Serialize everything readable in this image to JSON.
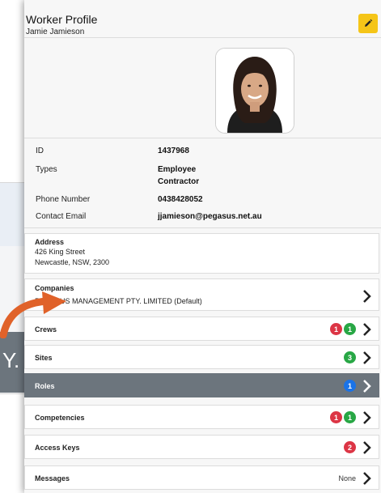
{
  "header": {
    "title": "Worker Profile",
    "subtitle": "Jamie Jamieson"
  },
  "details": [
    {
      "label": "ID",
      "value": "1437968"
    },
    {
      "label": "Types",
      "value": "Employee",
      "value2": "Contractor"
    },
    {
      "label": "Phone Number",
      "value": "0438428052"
    },
    {
      "label": "Contact Email",
      "value": "jjamieson@pegasus.net.au"
    }
  ],
  "address": {
    "label": "Address",
    "line1": "426 King Street",
    "line2": "Newcastle, NSW, 2300"
  },
  "companies": {
    "label": "Companies",
    "value": "PEGASUS MANAGEMENT PTY. LIMITED (Default)"
  },
  "nav": [
    {
      "label": "Crews",
      "badges": [
        {
          "count": "1",
          "color": "#dc3545"
        },
        {
          "count": "1",
          "color": "#28a745"
        }
      ]
    },
    {
      "label": "Sites",
      "badges": [
        {
          "count": "3",
          "color": "#28a745"
        }
      ]
    },
    {
      "label": "Roles",
      "badges": [
        {
          "count": "1",
          "color": "#1a73e8"
        }
      ],
      "active": true
    },
    {
      "label": "Competencies",
      "badges": [
        {
          "count": "1",
          "color": "#dc3545"
        },
        {
          "count": "1",
          "color": "#28a745"
        }
      ]
    },
    {
      "label": "Access Keys",
      "badges": [
        {
          "count": "2",
          "color": "#dc3545"
        }
      ]
    },
    {
      "label": "Messages",
      "status": "None"
    }
  ],
  "background": {
    "partial_text": "Y."
  },
  "colors": {
    "accent": "#f5c518",
    "active_row": "#6c757d",
    "arrow": "#e0622a"
  },
  "icons": {
    "edit": "pencil-icon",
    "chevron": "chevron-right-icon",
    "arrow": "curved-arrow-icon"
  }
}
